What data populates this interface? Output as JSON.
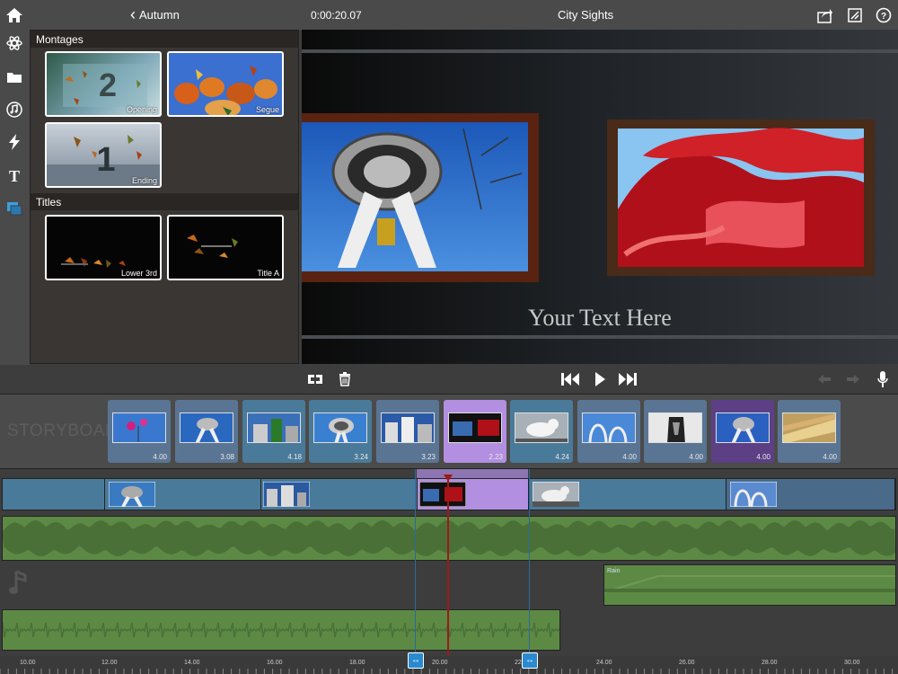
{
  "topbar": {
    "back_label": "Autumn",
    "timecode": "0:00:20.07",
    "project_title": "City Sights"
  },
  "sidebar": {
    "icons": [
      "home-icon",
      "effects-icon",
      "folder-icon",
      "music-icon",
      "lightning-icon",
      "text-icon",
      "montage-icon"
    ]
  },
  "browser": {
    "montages_header": "Montages",
    "titles_header": "Titles",
    "montages": [
      {
        "label": "Opening"
      },
      {
        "label": "Segue"
      },
      {
        "label": "Ending"
      }
    ],
    "titles": [
      {
        "label": "Lower 3rd"
      },
      {
        "label": "Title A"
      }
    ]
  },
  "preview": {
    "overlay_text": "Your Text Here"
  },
  "storyboard": {
    "label": "STORYBOAR",
    "clips": [
      {
        "duration": "4.00",
        "scene": "flower",
        "selected": false,
        "color": "#5a7594"
      },
      {
        "duration": "3.08",
        "scene": "tower",
        "selected": false,
        "color": "#5a7594"
      },
      {
        "duration": "4.18",
        "scene": "building",
        "selected": false,
        "color": "#4a7a99"
      },
      {
        "duration": "3.24",
        "scene": "tower2",
        "selected": false,
        "color": "#4a7a99"
      },
      {
        "duration": "3.23",
        "scene": "city",
        "selected": false,
        "color": "#5a7594"
      },
      {
        "duration": "2.23",
        "scene": "montage",
        "selected": true,
        "color": "#b28fe0"
      },
      {
        "duration": "4.24",
        "scene": "gull",
        "selected": false,
        "color": "#4a7a99"
      },
      {
        "duration": "4.00",
        "scene": "arches",
        "selected": false,
        "color": "#5a7594"
      },
      {
        "duration": "4.00",
        "scene": "sculpture",
        "selected": false,
        "color": "#5a7594"
      },
      {
        "duration": "4.00",
        "scene": "tower3",
        "selected": false,
        "color": "#5c3f85"
      },
      {
        "duration": "4.00",
        "scene": "glass",
        "selected": false,
        "color": "#5a7594"
      }
    ]
  },
  "timeline": {
    "audio_label": "Rain",
    "ruler_ticks": [
      "10.00",
      "12.00",
      "14.00",
      "16.00",
      "18.00",
      "20.00",
      "22",
      "24.00",
      "26.00",
      "28.00",
      "30.00"
    ]
  },
  "colors": {
    "accent": "#b28fe0",
    "video_track": "#4a7a99",
    "audio_track": "#6a9a4a",
    "playhead": "#a01818"
  }
}
